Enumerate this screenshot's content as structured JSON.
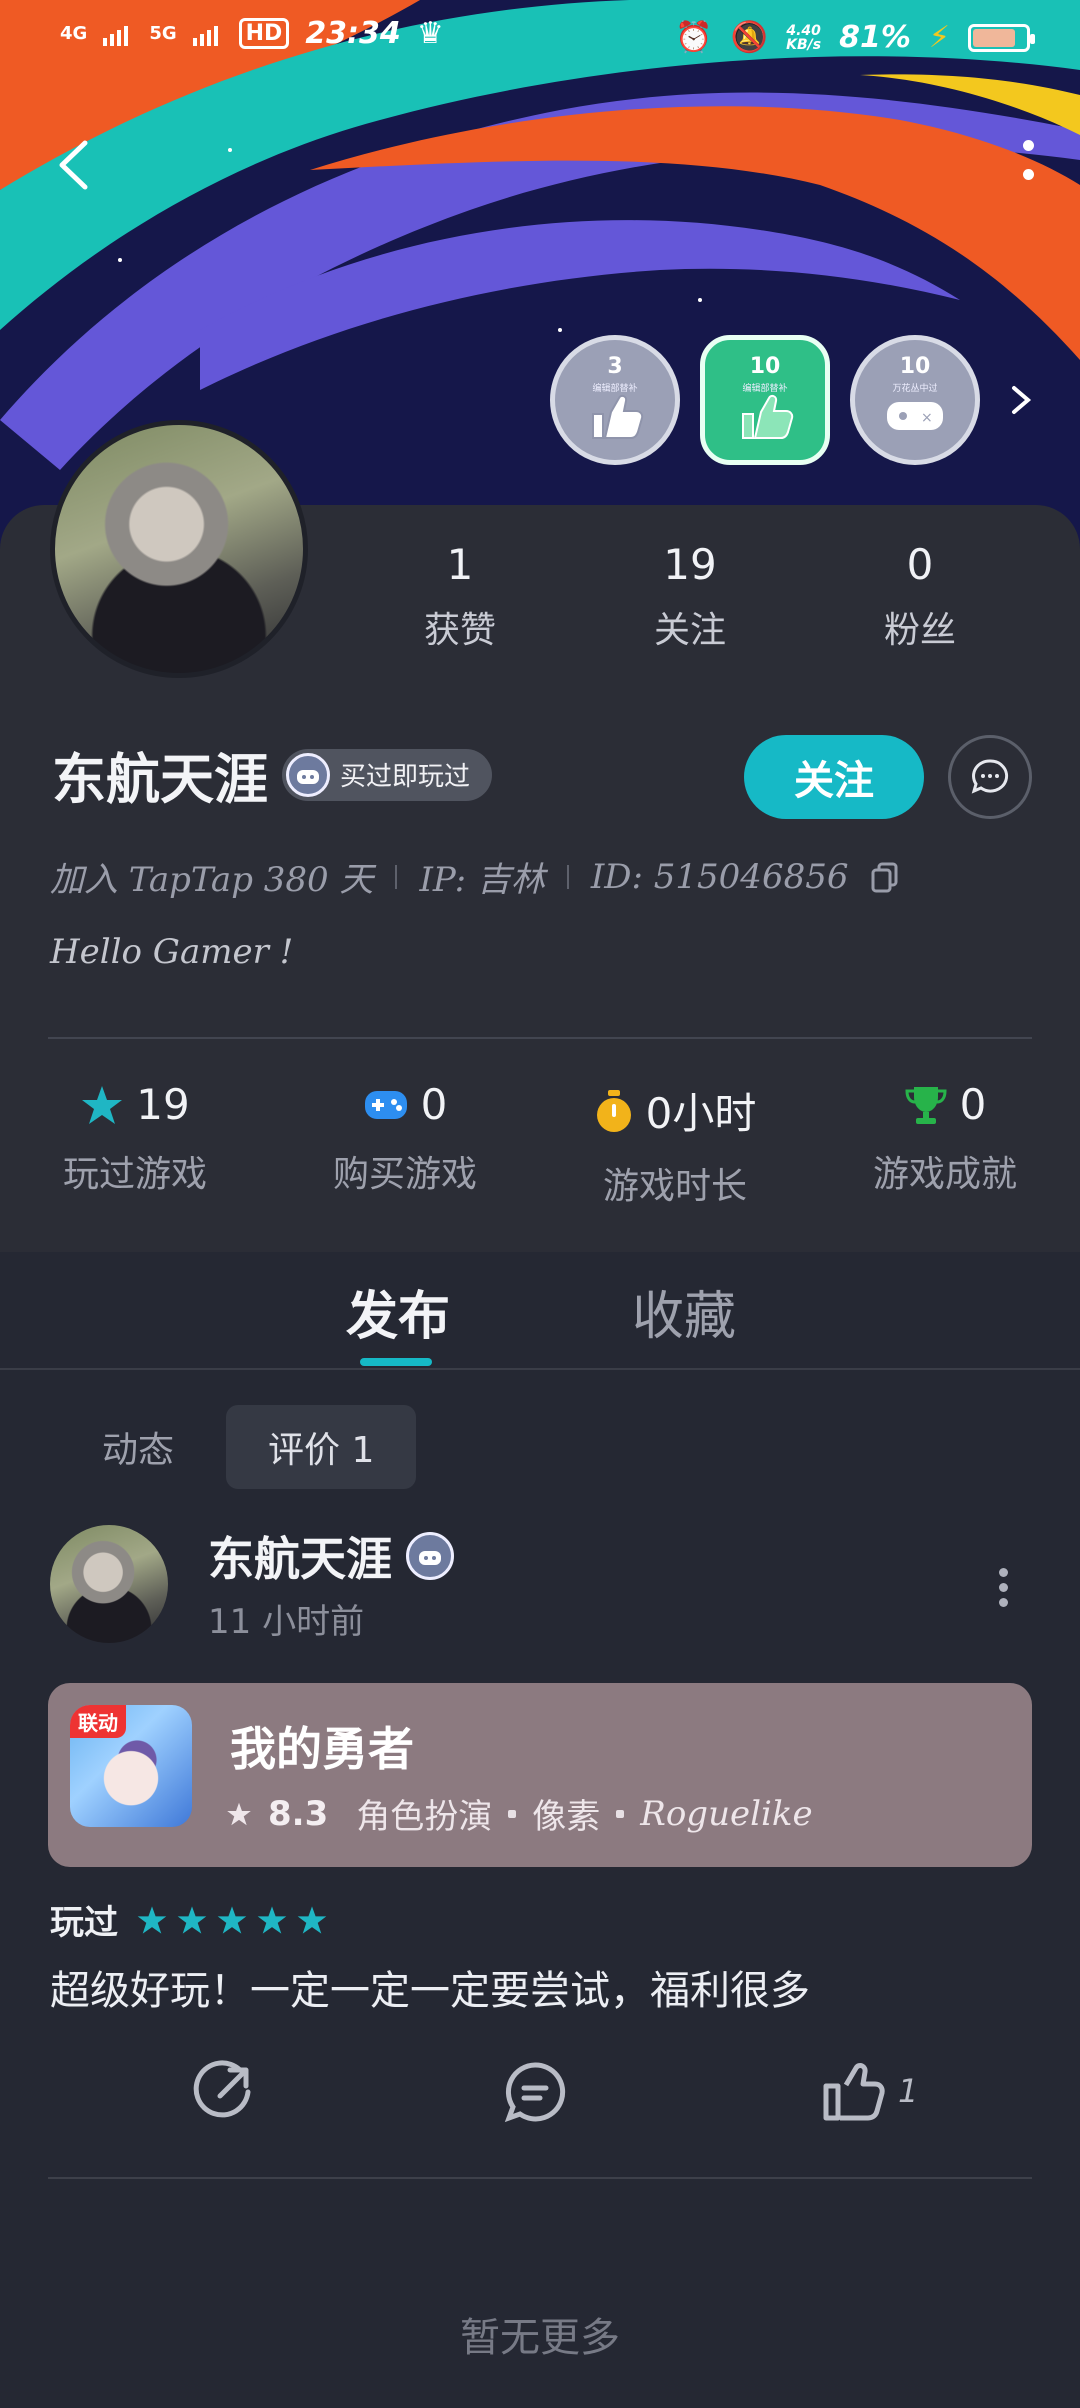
{
  "status_bar": {
    "network_1": "4G",
    "network_2": "5G",
    "hd": "HD",
    "time": "23:34",
    "net_speed": "4.40",
    "net_speed_unit": "KB/s",
    "battery": "81%",
    "battery_level": 0.81
  },
  "badges": [
    {
      "num": "3",
      "label": "编辑部替补"
    },
    {
      "num": "10",
      "label": "编辑部替补"
    },
    {
      "num": "10",
      "label": "万花丛中过"
    }
  ],
  "profile": {
    "stats": [
      {
        "value": "1",
        "label": "获赞"
      },
      {
        "value": "19",
        "label": "关注"
      },
      {
        "value": "0",
        "label": "粉丝"
      }
    ],
    "name": "东航天涯",
    "pill_text": "买过即玩过",
    "follow_label": "关注",
    "joined": "加入 TapTap 380 天",
    "ip": "IP: 吉林",
    "id": "ID: 515046856",
    "bio": "Hello Gamer !"
  },
  "game_stats": [
    {
      "value": "19",
      "label": "玩过游戏",
      "icon": "star-icon",
      "color": "#1fb6c4"
    },
    {
      "value": "0",
      "label": "购买游戏",
      "icon": "gamepad-icon",
      "color": "#2d8ef0"
    },
    {
      "value": "0小时",
      "label": "游戏时长",
      "icon": "stopwatch-icon",
      "color": "#f2b31a"
    },
    {
      "value": "0",
      "label": "游戏成就",
      "icon": "trophy-icon",
      "color": "#27b34a"
    }
  ],
  "tabs": [
    "发布",
    "收藏"
  ],
  "subtabs": [
    "动态",
    "评价 1"
  ],
  "post": {
    "author": "东航天涯",
    "time": "11 小时前",
    "game": {
      "tag": "联动",
      "title": "我的勇者",
      "score": "8.3",
      "tags": [
        "角色扮演",
        "像素",
        "Roguelike"
      ]
    },
    "played_label": "玩过",
    "rating": 5,
    "text": "超级好玩！一定一定一定要尝试，福利很多",
    "likes": "1"
  },
  "footer": "暂无更多"
}
